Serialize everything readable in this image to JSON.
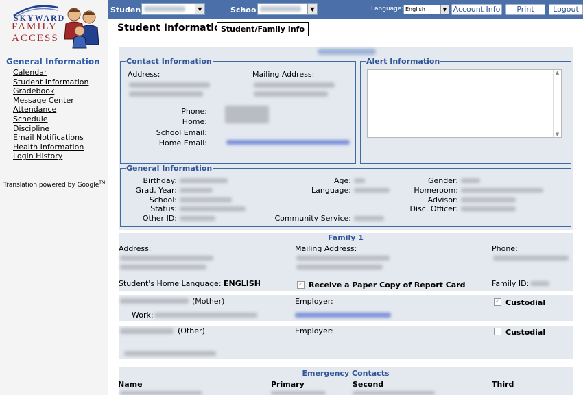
{
  "logo": {
    "line1": "SKYWARD",
    "line2": "FAMILY",
    "line3": "ACCESS"
  },
  "sidebar": {
    "heading": "General Information",
    "items": [
      {
        "label": "Calendar"
      },
      {
        "label": "Student Information"
      },
      {
        "label": "Gradebook"
      },
      {
        "label": "Message Center"
      },
      {
        "label": "Attendance"
      },
      {
        "label": "Schedule"
      },
      {
        "label": "Discipline"
      },
      {
        "label": "Email Notifications"
      },
      {
        "label": "Health Information"
      },
      {
        "label": "Login History"
      }
    ],
    "translation": "Translation powered by Google",
    "translation_tm": "TM"
  },
  "topbar": {
    "student_label": "Student:",
    "school_label": "School:",
    "language_label": "Language:",
    "language_value": "English",
    "account_info": "Account Info",
    "print": "Print",
    "logout": "Logout"
  },
  "main": {
    "title": "Student Information",
    "tab": "Student/Family Info"
  },
  "contact": {
    "legend": "Contact Information",
    "address": "Address:",
    "mailing_address": "Mailing Address:",
    "phone": "Phone:",
    "home": "Home:",
    "school_email": "School Email:",
    "home_email": "Home Email:"
  },
  "alert": {
    "legend": "Alert Information"
  },
  "general": {
    "legend": "General Information",
    "birthday": "Birthday:",
    "grad_year": "Grad. Year:",
    "school": "School:",
    "status": "Status:",
    "other_id": "Other ID:",
    "age": "Age:",
    "language": "Language:",
    "community_service": "Community Service:",
    "gender": "Gender:",
    "homeroom": "Homeroom:",
    "advisor": "Advisor:",
    "disc_officer": "Disc. Officer:"
  },
  "family": {
    "heading": "Family 1",
    "address": "Address:",
    "mailing_address": "Mailing Address:",
    "phone": "Phone:",
    "home_language_label": "Student's Home Language:",
    "home_language_value": "ENGLISH",
    "paper_copy": "Receive a Paper Copy of Report Card",
    "family_id": "Family ID:",
    "guardian1_relation": "(Mother)",
    "employer": "Employer:",
    "custodial": "Custodial",
    "work": "Work:",
    "guardian2_relation": "(Other)"
  },
  "emergency": {
    "heading": "Emergency Contacts",
    "columns": [
      "Name",
      "Primary",
      "Second",
      "Third"
    ]
  },
  "colors": {
    "topbar": "#4b6fa9",
    "accent": "#2f5597",
    "panel": "#e4e8ef"
  }
}
